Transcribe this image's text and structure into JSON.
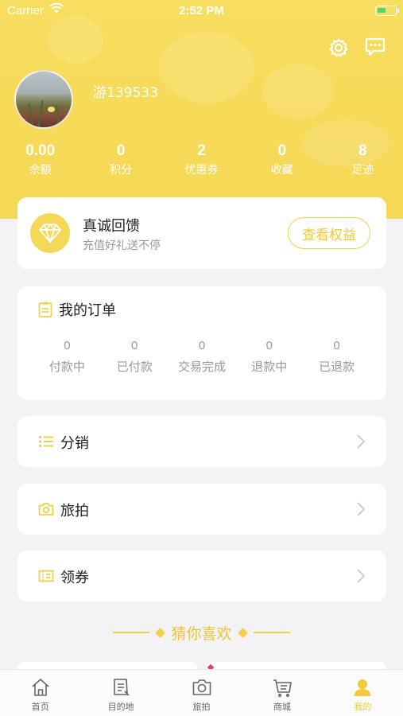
{
  "status_bar": {
    "carrier": "Carrier",
    "time": "2:52 PM"
  },
  "header": {
    "settings_icon": "gear-icon",
    "message_icon": "chat-bubble-icon"
  },
  "profile": {
    "username": "游139533"
  },
  "stats": [
    {
      "value": "0.00",
      "label": "余额"
    },
    {
      "value": "0",
      "label": "积分"
    },
    {
      "value": "2",
      "label": "优惠券"
    },
    {
      "value": "0",
      "label": "收藏"
    },
    {
      "value": "8",
      "label": "足迹"
    }
  ],
  "vip": {
    "title": "真诚回馈",
    "subtitle": "充值好礼送不停",
    "button": "查看权益"
  },
  "orders": {
    "title": "我的订单",
    "items": [
      {
        "count": "0",
        "label": "付款中"
      },
      {
        "count": "0",
        "label": "已付款"
      },
      {
        "count": "0",
        "label": "交易完成"
      },
      {
        "count": "0",
        "label": "退款中"
      },
      {
        "count": "0",
        "label": "已退款"
      }
    ]
  },
  "menu": [
    {
      "label": "分销",
      "icon": "list-icon"
    },
    {
      "label": "旅拍",
      "icon": "camera-icon"
    },
    {
      "label": "领券",
      "icon": "ticket-icon"
    }
  ],
  "recommend": {
    "title": "猜你喜欢"
  },
  "tabbar": [
    {
      "label": "首页",
      "icon": "home-icon"
    },
    {
      "label": "目的地",
      "icon": "destination-icon"
    },
    {
      "label": "旅拍",
      "icon": "camera-icon"
    },
    {
      "label": "商城",
      "icon": "cart-icon"
    },
    {
      "label": "我的",
      "icon": "user-icon",
      "active": true
    }
  ],
  "colors": {
    "accent": "#F6D858",
    "accent_text": "#F0C93A",
    "background": "#F3F3F5"
  }
}
